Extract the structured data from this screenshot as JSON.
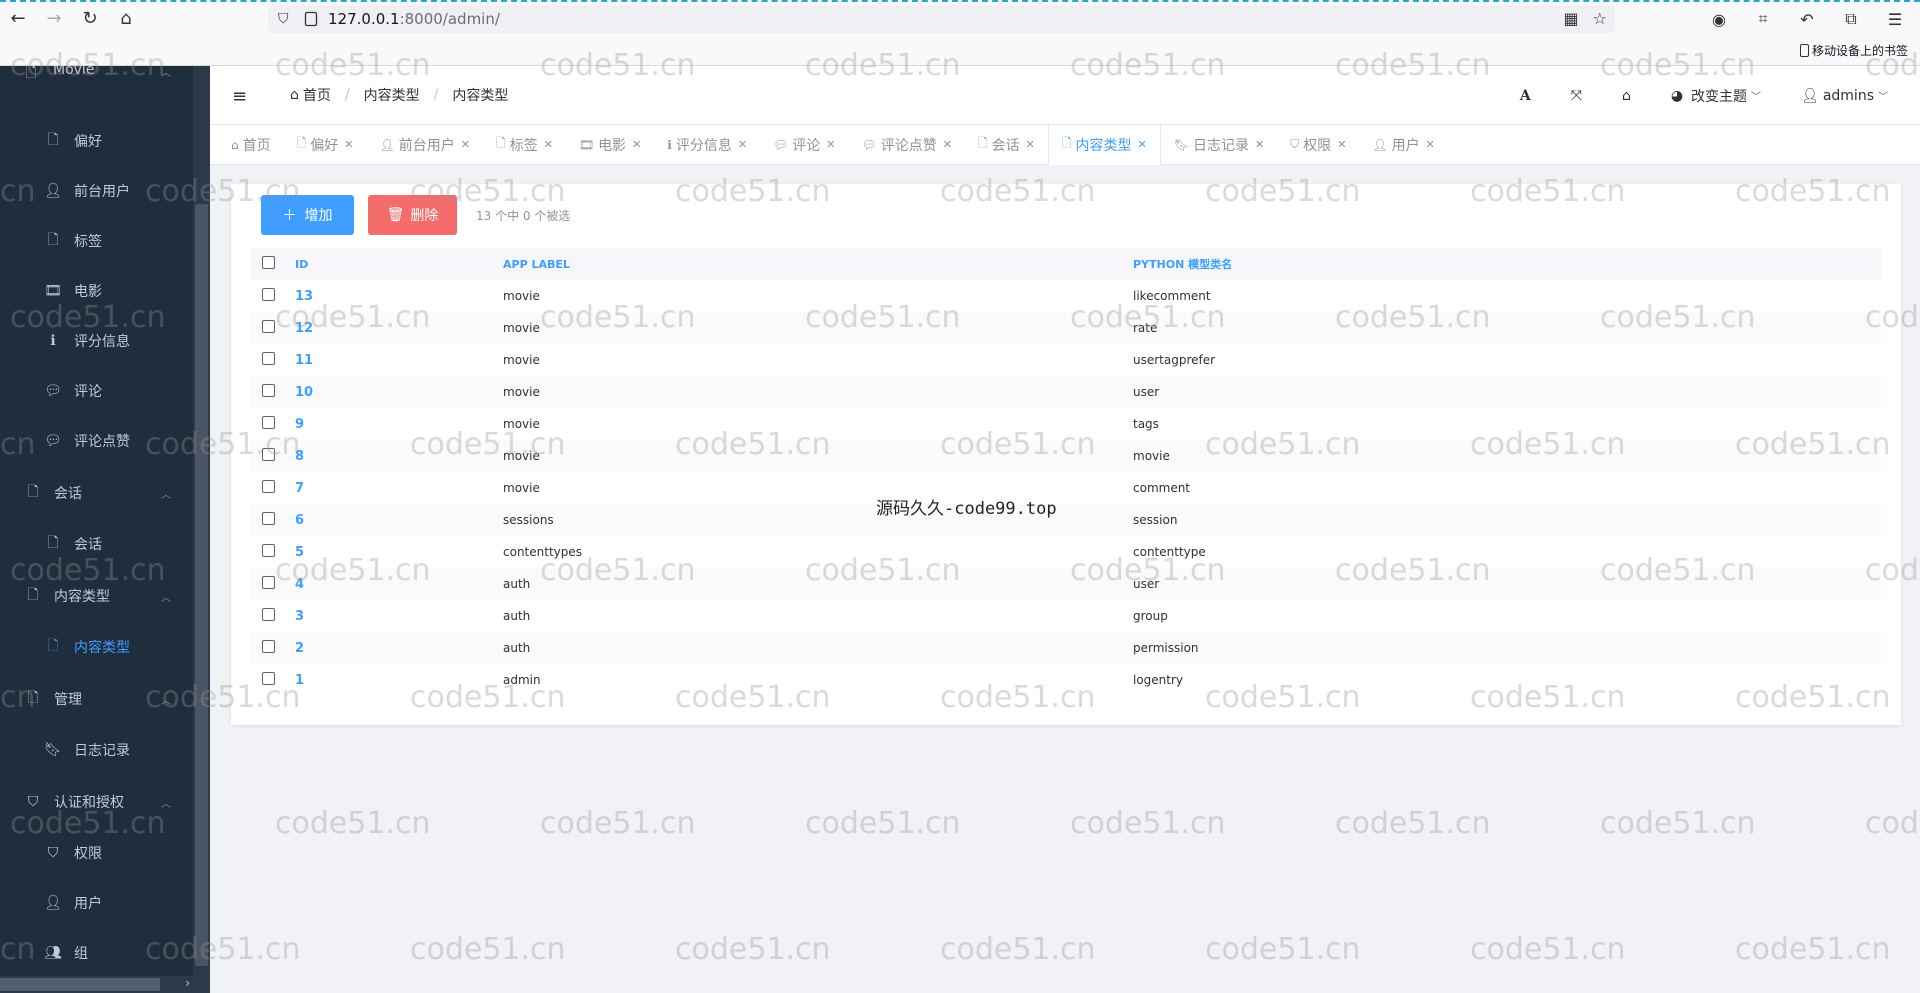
{
  "browser": {
    "url_host": "127.0.0.1",
    "url_rest": ":8000/admin/",
    "bookmark_mobile": "移动设备上的书签"
  },
  "sidebar": {
    "top_group": "Movie",
    "items": [
      {
        "label": "偏好",
        "icon": "file-icon"
      },
      {
        "label": "前台用户",
        "icon": "user-icon"
      },
      {
        "label": "标签",
        "icon": "file-icon"
      },
      {
        "label": "电影",
        "icon": "film-icon"
      },
      {
        "label": "评分信息",
        "icon": "info-icon"
      },
      {
        "label": "评论",
        "icon": "comment-icon"
      },
      {
        "label": "评论点赞",
        "icon": "comment-icon"
      }
    ],
    "group_session": "会话",
    "session_item": "会话",
    "group_contenttype": "内容类型",
    "contenttype_item": "内容类型",
    "group_admin": "管理",
    "admin_item": "日志记录",
    "group_auth": "认证和授权",
    "auth_items": [
      {
        "label": "权限",
        "icon": "shield-icon"
      },
      {
        "label": "用户",
        "icon": "user-icon"
      },
      {
        "label": "组",
        "icon": "users-icon"
      }
    ]
  },
  "header": {
    "breadcrumb": [
      "首页",
      "内容类型",
      "内容类型"
    ],
    "theme_label": "改变主题",
    "user_label": "admins"
  },
  "tabs": [
    {
      "label": "首页",
      "icon": "home-icon",
      "closable": false
    },
    {
      "label": "偏好",
      "icon": "file-icon",
      "closable": true
    },
    {
      "label": "前台用户",
      "icon": "user-icon",
      "closable": true
    },
    {
      "label": "标签",
      "icon": "file-icon",
      "closable": true
    },
    {
      "label": "电影",
      "icon": "film-icon",
      "closable": true
    },
    {
      "label": "评分信息",
      "icon": "info-icon",
      "closable": true
    },
    {
      "label": "评论",
      "icon": "comment-icon",
      "closable": true
    },
    {
      "label": "评论点赞",
      "icon": "comment-icon",
      "closable": true
    },
    {
      "label": "会话",
      "icon": "file-icon",
      "closable": true
    },
    {
      "label": "内容类型",
      "icon": "file-icon",
      "closable": true,
      "active": true
    },
    {
      "label": "日志记录",
      "icon": "bookmark-icon",
      "closable": true
    },
    {
      "label": "权限",
      "icon": "shield-icon",
      "closable": true
    },
    {
      "label": "用户",
      "icon": "user-icon",
      "closable": true
    }
  ],
  "toolbar": {
    "add_label": "增加",
    "delete_label": "删除",
    "selection_text": "13 个中 0 个被选"
  },
  "table": {
    "headers": {
      "id": "ID",
      "app_label": "APP LABEL",
      "model": "PYTHON 模型类名"
    },
    "rows": [
      {
        "id": "13",
        "app": "movie",
        "model": "likecomment"
      },
      {
        "id": "12",
        "app": "movie",
        "model": "rate"
      },
      {
        "id": "11",
        "app": "movie",
        "model": "usertagprefer"
      },
      {
        "id": "10",
        "app": "movie",
        "model": "user"
      },
      {
        "id": "9",
        "app": "movie",
        "model": "tags"
      },
      {
        "id": "8",
        "app": "movie",
        "model": "movie"
      },
      {
        "id": "7",
        "app": "movie",
        "model": "comment"
      },
      {
        "id": "6",
        "app": "sessions",
        "model": "session"
      },
      {
        "id": "5",
        "app": "contenttypes",
        "model": "contenttype"
      },
      {
        "id": "4",
        "app": "auth",
        "model": "user"
      },
      {
        "id": "3",
        "app": "auth",
        "model": "group"
      },
      {
        "id": "2",
        "app": "auth",
        "model": "permission"
      },
      {
        "id": "1",
        "app": "admin",
        "model": "logentry"
      }
    ]
  },
  "overlay_text": "源码久久-code99.top",
  "watermark_text": "code51.cn",
  "colors": {
    "primary": "#409eff",
    "danger": "#f56c6c",
    "sidebar_bg": "#1f2d3d"
  }
}
